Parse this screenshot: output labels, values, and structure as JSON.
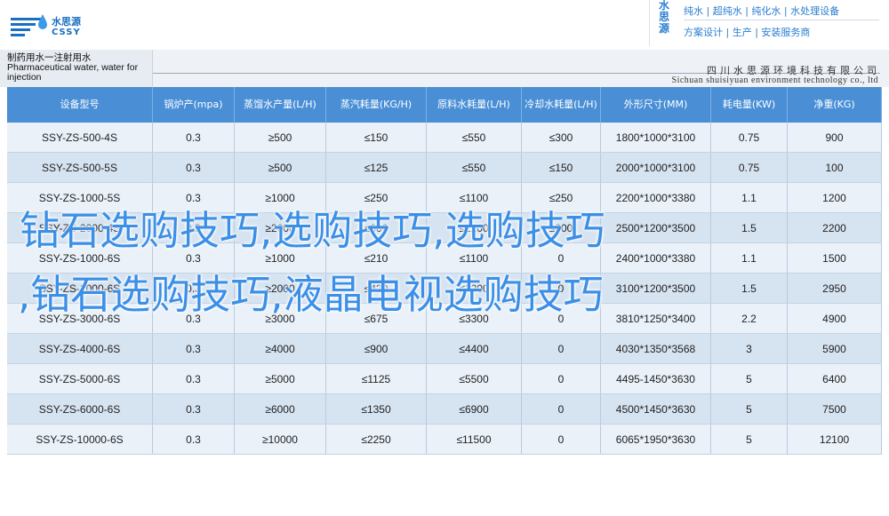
{
  "header": {
    "logo_cn": "水思源",
    "logo_en": "CSSY",
    "brand_vertical": "水思源",
    "brand_line1": "纯水 | 超纯水 | 纯化水 | 水处理设备",
    "brand_line2": "方案设计 | 生产 | 安装服务商"
  },
  "title_strip": {
    "left_title": "制药用水一注射用水\nPharmaceutical water, water for injection",
    "right_cn": "四川水思源环境科技有限公司",
    "right_en": "Sichuan shuisiyuan environment technology co., ltd"
  },
  "table": {
    "headers": [
      "设备型号",
      "锅炉产(mpa)",
      "蒸馏水产量(L/H)",
      "蒸汽耗量(KG/H)",
      "原料水耗量(L/H)",
      "冷却水耗量(L/H)",
      "外形尺寸(MM)",
      "耗电量(KW)",
      "净重(KG)"
    ],
    "rows": [
      [
        "SSY-ZS-500-4S",
        "0.3",
        "≥500",
        "≤150",
        "≤550",
        "≤300",
        "1800*1000*3100",
        "0.75",
        "900"
      ],
      [
        "SSY-ZS-500-5S",
        "0.3",
        "≥500",
        "≤125",
        "≤550",
        "≤150",
        "2000*1000*3100",
        "0.75",
        "100"
      ],
      [
        "SSY-ZS-1000-5S",
        "0.3",
        "≥1000",
        "≤250",
        "≤1100",
        "≤250",
        "2200*1000*3380",
        "1.1",
        "1200"
      ],
      [
        "SSY-ZS-2000-4S",
        "0.3",
        "≥2000",
        "≤600",
        "≤2200",
        "≤800",
        "2500*1200*3500",
        "1.5",
        "2200"
      ],
      [
        "SSY-ZS-1000-6S",
        "0.3",
        "≥1000",
        "≤210",
        "≤1100",
        "0",
        "2400*1000*3380",
        "1.1",
        "1500"
      ],
      [
        "SSY-ZS-2000-6S",
        "0.3",
        "≥2000",
        "≤420",
        "≤2200",
        "0",
        "3100*1200*3500",
        "1.5",
        "2950"
      ],
      [
        "SSY-ZS-3000-6S",
        "0.3",
        "≥3000",
        "≤675",
        "≤3300",
        "0",
        "3810*1250*3400",
        "2.2",
        "4900"
      ],
      [
        "SSY-ZS-4000-6S",
        "0.3",
        "≥4000",
        "≤900",
        "≤4400",
        "0",
        "4030*1350*3568",
        "3",
        "5900"
      ],
      [
        "SSY-ZS-5000-6S",
        "0.3",
        "≥5000",
        "≤1125",
        "≤5500",
        "0",
        "4495-1450*3630",
        "5",
        "6400"
      ],
      [
        "SSY-ZS-6000-6S",
        "0.3",
        "≥6000",
        "≤1350",
        "≤6900",
        "0",
        "4500*1450*3630",
        "5",
        "7500"
      ],
      [
        "SSY-ZS-10000-6S",
        "0.3",
        "≥10000",
        "≤2250",
        "≤11500",
        "0",
        "6065*1950*3630",
        "5",
        "12100"
      ]
    ]
  },
  "overlay": {
    "line1": "钻石选购技巧,选购技巧,选购技巧",
    "line2": ",钻石选购技巧,液晶电视选购技巧"
  },
  "colors": {
    "header_row": "#4a8fd6",
    "row_light": "#eaf1f9",
    "row_dark": "#d6e3f1",
    "overlay_text": "#3b8fe6",
    "brand_blue": "#2a7ed0"
  }
}
